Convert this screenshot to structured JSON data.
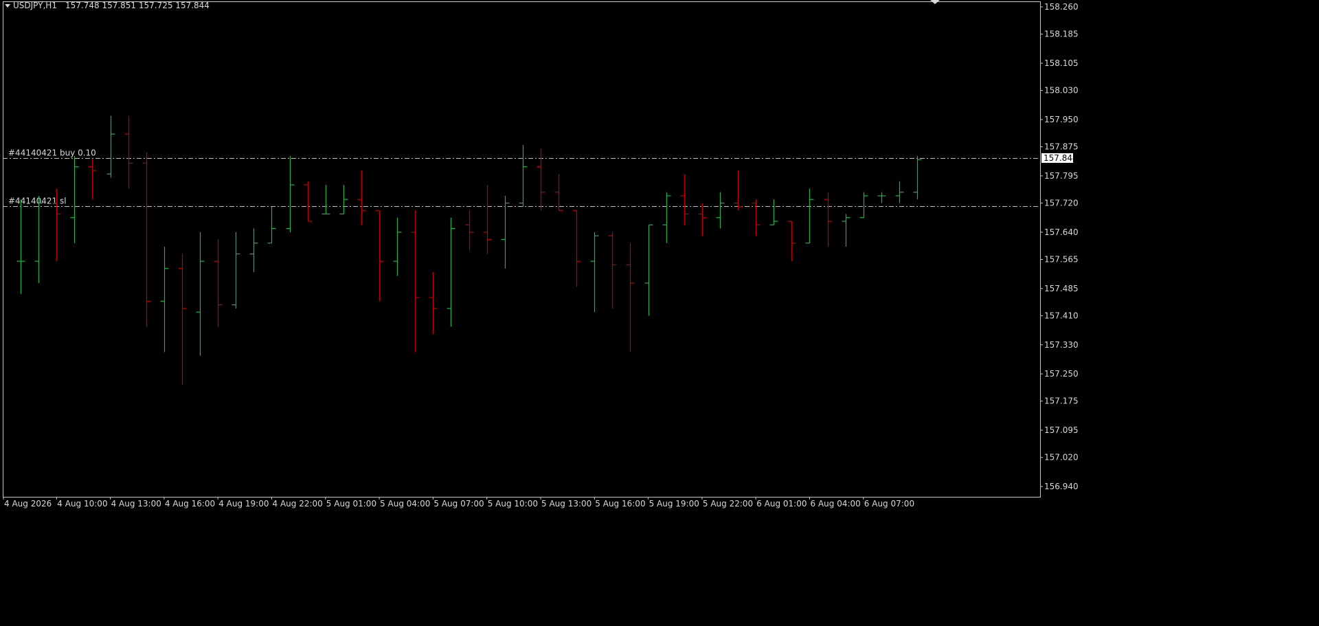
{
  "header": {
    "symbol_timeframe": "USDJPY,H1",
    "ohlc": "157.748 157.851 157.725 157.844",
    "menu_icon": "triangle-down-icon"
  },
  "colors": {
    "background": "#000000",
    "frame": "#c8c8c8",
    "text": "#d8d8d8",
    "bull": "#22b14c",
    "bear": "#c00000",
    "trade_line": "#bdbdbd",
    "price_label_bg": "#ffffff",
    "price_label_text": "#000000"
  },
  "chart_data": {
    "type": "ohlc",
    "title": "USDJPY,H1",
    "ylim": [
      156.9,
      158.28
    ],
    "yticks": [
      "158.260",
      "158.185",
      "158.105",
      "158.030",
      "157.950",
      "157.875",
      "157.795",
      "157.720",
      "157.640",
      "157.565",
      "157.485",
      "157.410",
      "157.330",
      "157.250",
      "157.175",
      "157.095",
      "157.020",
      "156.940"
    ],
    "xticks": [
      {
        "index": 0,
        "label": "4 Aug 2026"
      },
      {
        "index": 3,
        "label": "4 Aug 10:00"
      },
      {
        "index": 6,
        "label": "4 Aug 13:00"
      },
      {
        "index": 9,
        "label": "4 Aug 16:00"
      },
      {
        "index": 12,
        "label": "4 Aug 19:00"
      },
      {
        "index": 15,
        "label": "4 Aug 22:00"
      },
      {
        "index": 18,
        "label": "5 Aug 01:00"
      },
      {
        "index": 21,
        "label": "5 Aug 04:00"
      },
      {
        "index": 24,
        "label": "5 Aug 07:00"
      },
      {
        "index": 27,
        "label": "5 Aug 10:00"
      },
      {
        "index": 30,
        "label": "5 Aug 13:00"
      },
      {
        "index": 33,
        "label": "5 Aug 16:00"
      },
      {
        "index": 36,
        "label": "5 Aug 19:00"
      },
      {
        "index": 39,
        "label": "5 Aug 22:00"
      },
      {
        "index": 42,
        "label": "6 Aug 01:00"
      },
      {
        "index": 45,
        "label": "6 Aug 04:00"
      },
      {
        "index": 48,
        "label": "6 Aug 07:00"
      }
    ],
    "bars": [
      {
        "o": 157.56,
        "h": 157.73,
        "l": 157.47,
        "c": 157.56
      },
      {
        "o": 157.56,
        "h": 157.74,
        "l": 157.5,
        "c": 157.72
      },
      {
        "o": 157.72,
        "h": 157.76,
        "l": 157.56,
        "c": 157.69
      },
      {
        "o": 157.68,
        "h": 157.85,
        "l": 157.61,
        "c": 157.82
      },
      {
        "o": 157.82,
        "h": 157.84,
        "l": 157.73,
        "c": 157.81
      },
      {
        "o": 157.8,
        "h": 157.96,
        "l": 157.79,
        "c": 157.91
      },
      {
        "o": 157.91,
        "h": 157.96,
        "l": 157.76,
        "c": 157.83
      },
      {
        "o": 157.83,
        "h": 157.86,
        "l": 157.38,
        "c": 157.45
      },
      {
        "o": 157.45,
        "h": 157.6,
        "l": 157.31,
        "c": 157.54
      },
      {
        "o": 157.54,
        "h": 157.58,
        "l": 157.22,
        "c": 157.43
      },
      {
        "o": 157.42,
        "h": 157.64,
        "l": 157.3,
        "c": 157.56
      },
      {
        "o": 157.56,
        "h": 157.62,
        "l": 157.38,
        "c": 157.44
      },
      {
        "o": 157.44,
        "h": 157.64,
        "l": 157.43,
        "c": 157.58
      },
      {
        "o": 157.58,
        "h": 157.65,
        "l": 157.53,
        "c": 157.61
      },
      {
        "o": 157.61,
        "h": 157.71,
        "l": 157.61,
        "c": 157.65
      },
      {
        "o": 157.65,
        "h": 157.85,
        "l": 157.64,
        "c": 157.77
      },
      {
        "o": 157.77,
        "h": 157.78,
        "l": 157.67,
        "c": 157.67
      },
      {
        "o": 157.69,
        "h": 157.77,
        "l": 157.69,
        "c": 157.69
      },
      {
        "o": 157.69,
        "h": 157.77,
        "l": 157.69,
        "c": 157.73
      },
      {
        "o": 157.73,
        "h": 157.81,
        "l": 157.66,
        "c": 157.7
      },
      {
        "o": 157.7,
        "h": 157.7,
        "l": 157.45,
        "c": 157.56
      },
      {
        "o": 157.56,
        "h": 157.68,
        "l": 157.52,
        "c": 157.64
      },
      {
        "o": 157.64,
        "h": 157.7,
        "l": 157.31,
        "c": 157.46
      },
      {
        "o": 157.46,
        "h": 157.53,
        "l": 157.36,
        "c": 157.43
      },
      {
        "o": 157.43,
        "h": 157.68,
        "l": 157.38,
        "c": 157.65
      },
      {
        "o": 157.66,
        "h": 157.7,
        "l": 157.59,
        "c": 157.64
      },
      {
        "o": 157.64,
        "h": 157.77,
        "l": 157.58,
        "c": 157.62
      },
      {
        "o": 157.62,
        "h": 157.74,
        "l": 157.54,
        "c": 157.72
      },
      {
        "o": 157.72,
        "h": 157.88,
        "l": 157.71,
        "c": 157.82
      },
      {
        "o": 157.82,
        "h": 157.87,
        "l": 157.7,
        "c": 157.75
      },
      {
        "o": 157.75,
        "h": 157.8,
        "l": 157.7,
        "c": 157.7
      },
      {
        "o": 157.7,
        "h": 157.7,
        "l": 157.49,
        "c": 157.56
      },
      {
        "o": 157.56,
        "h": 157.64,
        "l": 157.42,
        "c": 157.63
      },
      {
        "o": 157.63,
        "h": 157.64,
        "l": 157.43,
        "c": 157.55
      },
      {
        "o": 157.55,
        "h": 157.61,
        "l": 157.31,
        "c": 157.5
      },
      {
        "o": 157.5,
        "h": 157.66,
        "l": 157.41,
        "c": 157.66
      },
      {
        "o": 157.66,
        "h": 157.75,
        "l": 157.61,
        "c": 157.74
      },
      {
        "o": 157.74,
        "h": 157.8,
        "l": 157.66,
        "c": 157.69
      },
      {
        "o": 157.69,
        "h": 157.72,
        "l": 157.63,
        "c": 157.68
      },
      {
        "o": 157.68,
        "h": 157.75,
        "l": 157.65,
        "c": 157.72
      },
      {
        "o": 157.72,
        "h": 157.81,
        "l": 157.7,
        "c": 157.71
      },
      {
        "o": 157.72,
        "h": 157.73,
        "l": 157.63,
        "c": 157.66
      },
      {
        "o": 157.66,
        "h": 157.73,
        "l": 157.66,
        "c": 157.67
      },
      {
        "o": 157.67,
        "h": 157.67,
        "l": 157.56,
        "c": 157.61
      },
      {
        "o": 157.61,
        "h": 157.76,
        "l": 157.61,
        "c": 157.73
      },
      {
        "o": 157.73,
        "h": 157.75,
        "l": 157.6,
        "c": 157.67
      },
      {
        "o": 157.67,
        "h": 157.69,
        "l": 157.6,
        "c": 157.68
      },
      {
        "o": 157.68,
        "h": 157.75,
        "l": 157.68,
        "c": 157.74
      },
      {
        "o": 157.74,
        "h": 157.75,
        "l": 157.72,
        "c": 157.74
      },
      {
        "o": 157.74,
        "h": 157.78,
        "l": 157.72,
        "c": 157.75
      },
      {
        "o": 157.75,
        "h": 157.85,
        "l": 157.73,
        "c": 157.84
      }
    ],
    "lines": [
      {
        "price": 157.844,
        "label": "#44140421 buy 0.10"
      },
      {
        "price": 157.712,
        "label": "#44140421 sl"
      }
    ],
    "current_price": {
      "value": 157.844,
      "label": "157.844"
    }
  }
}
